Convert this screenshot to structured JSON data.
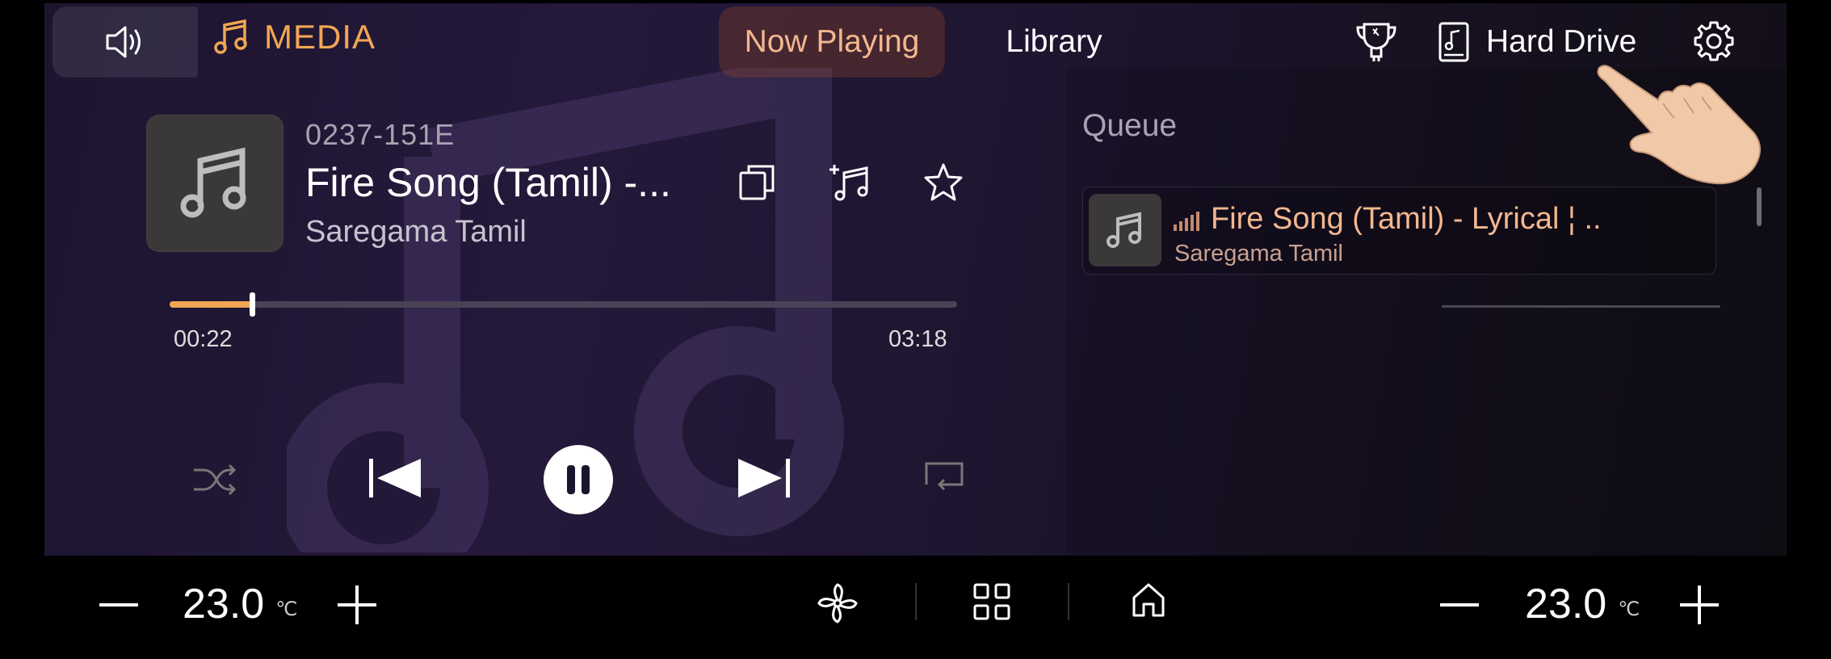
{
  "header": {
    "app_title": "MEDIA",
    "tabs": [
      {
        "label": "Now Playing",
        "active": true
      },
      {
        "label": "Library",
        "active": false
      }
    ],
    "source_label": "Hard Drive"
  },
  "now_playing": {
    "track_id": "0237-151E",
    "title": "Fire Song (Tamil) -...",
    "artist": "Saregama Tamil",
    "elapsed": "00:22",
    "duration": "03:18",
    "progress_fraction": 0.105
  },
  "queue": {
    "label": "Queue",
    "items": [
      {
        "title": "Fire Song (Tamil) - Lyrical ¦ ..",
        "artist": "Saregama Tamil",
        "playing": true
      }
    ]
  },
  "climate": {
    "left_temp": "23.0",
    "right_temp": "23.0",
    "unit": "℃"
  },
  "colors": {
    "accent": "#f2a653",
    "active_tab_text": "#f3b78f",
    "background": "#1d1530"
  },
  "icons": [
    "speaker-icon",
    "music-note-icon",
    "trophy-icon",
    "hard-drive-icon",
    "settings-gear-icon",
    "copy-icon",
    "add-to-playlist-icon",
    "star-icon",
    "shuffle-icon",
    "previous-icon",
    "pause-icon",
    "next-icon",
    "repeat-icon",
    "fan-icon",
    "apps-grid-icon",
    "home-icon",
    "minus-icon",
    "plus-icon"
  ]
}
